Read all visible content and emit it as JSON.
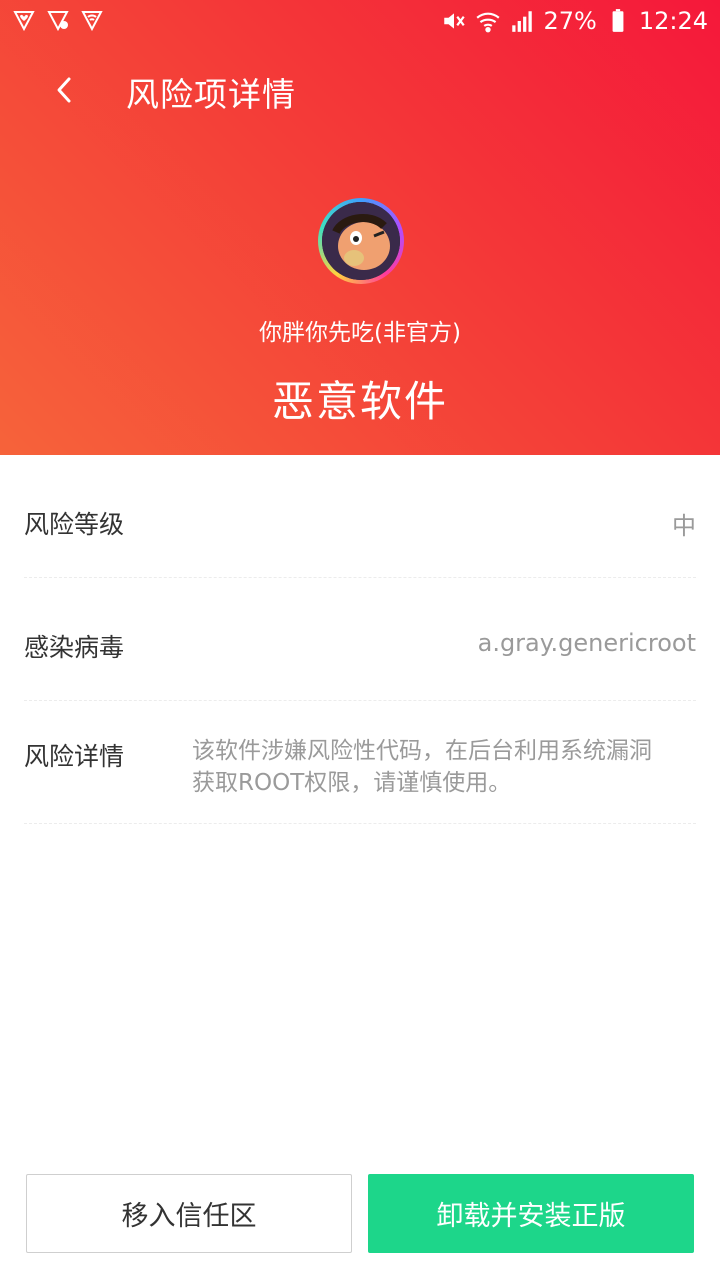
{
  "status_bar": {
    "battery": "27%",
    "time": "12:24",
    "network": "4G"
  },
  "header": {
    "title": "风险项详情"
  },
  "app": {
    "name": "你胖你先吃(非官方)",
    "risk_type": "恶意软件"
  },
  "details": [
    {
      "label": "风险等级",
      "value": "中"
    },
    {
      "label": "感染病毒",
      "value": "a.gray.genericroot"
    },
    {
      "label": "风险详情",
      "value_line1": "该软件涉嫌风险性代码，在后台利用系统漏洞",
      "value_line2": "获取ROOT权限，请谨慎使用。"
    }
  ],
  "actions": {
    "trust_label": "移入信任区",
    "uninstall_label": "卸载并安装正版"
  },
  "colors": {
    "hero_gradient": [
      "#f5183a",
      "#f6633a"
    ],
    "primary_button": "#1dd68a"
  }
}
